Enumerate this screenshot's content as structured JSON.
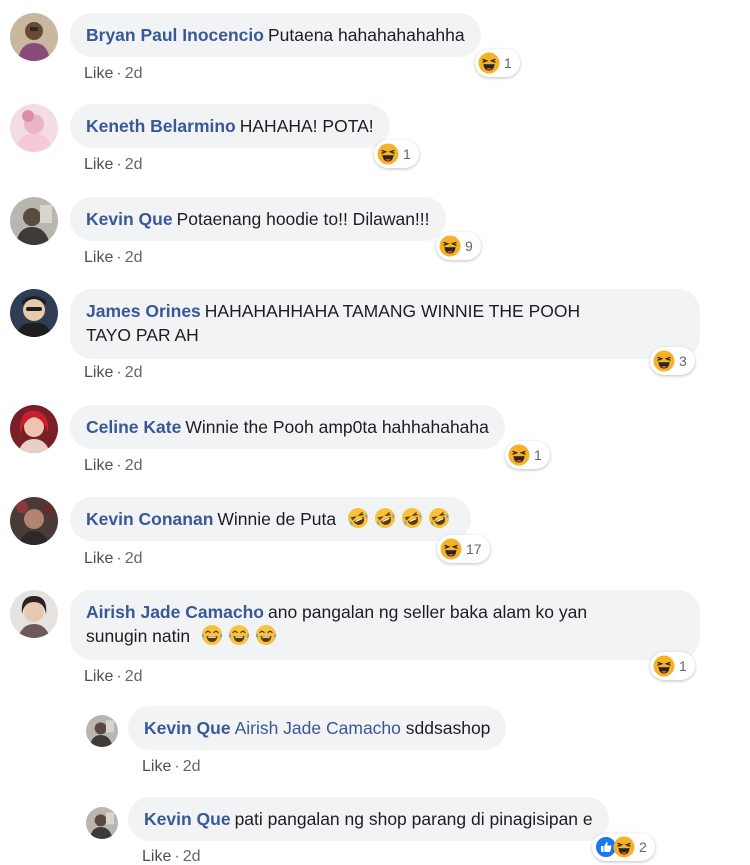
{
  "comments": [
    {
      "author": "Bryan Paul Inocencio",
      "text": "Putaena hahahahahahha",
      "like": "Like",
      "time": "2d",
      "reaction_count": "1"
    },
    {
      "author": "Keneth Belarmino",
      "text": "HAHAHA! POTA!",
      "like": "Like",
      "time": "2d",
      "reaction_count": "1"
    },
    {
      "author": "Kevin Que",
      "text": "Potaenang hoodie to!! Dilawan!!!",
      "like": "Like",
      "time": "2d",
      "reaction_count": "9"
    },
    {
      "author": "James Orines",
      "text_line1": "HAHAHAHHAHA TAMANG WINNIE THE POOH",
      "text_line2": "TAYO PAR AH",
      "like": "Like",
      "time": "2d",
      "reaction_count": "3"
    },
    {
      "author": "Celine Kate",
      "text": "Winnie the Pooh amp0ta hahhahahaha",
      "like": "Like",
      "time": "2d",
      "reaction_count": "1"
    },
    {
      "author": "Kevin Conanan",
      "text": "Winnie de Puta",
      "like": "Like",
      "time": "2d",
      "reaction_count": "17"
    },
    {
      "author": "Airish Jade Camacho",
      "text_line1": "ano pangalan ng seller baka alam ko yan",
      "text_line2": "sunugin natin",
      "like": "Like",
      "time": "2d",
      "reaction_count": "1"
    }
  ],
  "replies": [
    {
      "author": "Kevin Que",
      "mention": "Airish Jade Camacho",
      "text": "sddsashop",
      "like": "Like",
      "time": "2d"
    },
    {
      "author": "Kevin Que",
      "text": "pati pangalan ng shop parang di pinagisipan e",
      "like": "Like",
      "time": "2d",
      "reaction_count": "2"
    }
  ],
  "icons": {
    "reaction_haha": "haha-reaction-icon",
    "reaction_like": "like-reaction-icon",
    "emoji_rofl": "rolling-on-floor-laughing-emoji",
    "emoji_joy": "tears-of-joy-emoji"
  },
  "colors": {
    "author": "#385898",
    "bubble": "#f2f3f5",
    "meta": "#606770",
    "haha": "#f7b125",
    "like": "#1877f2"
  }
}
